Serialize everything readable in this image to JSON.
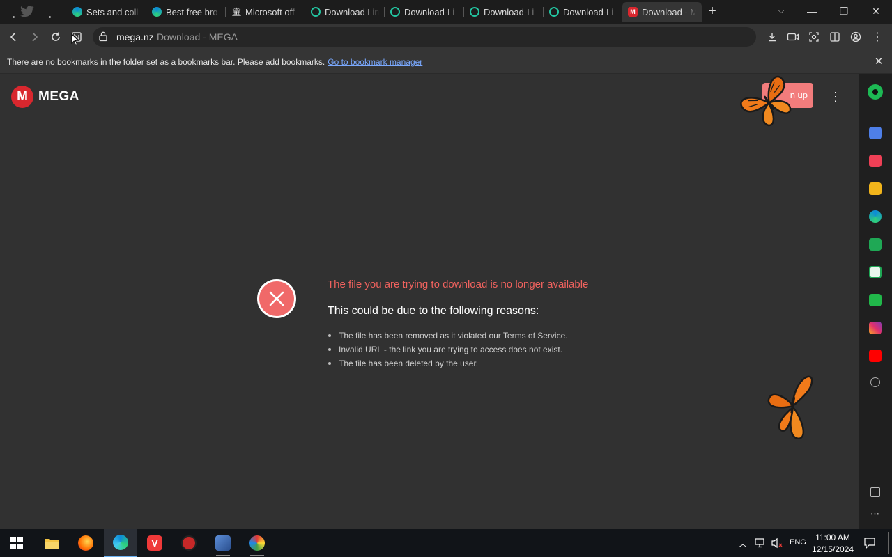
{
  "tabs": [
    {
      "title": "Sets and coll",
      "favicon": "edge-icon"
    },
    {
      "title": "Best free bro",
      "favicon": "edge-icon"
    },
    {
      "title": "Microsoft off",
      "favicon": "building-icon"
    },
    {
      "title": "Download Lin",
      "favicon": "ring-icon"
    },
    {
      "title": "Download-Li",
      "favicon": "ring-icon"
    },
    {
      "title": "Download-Li",
      "favicon": "ring-icon"
    },
    {
      "title": "Download-Li",
      "favicon": "ring-icon"
    },
    {
      "title": "Download - M",
      "favicon": "mega-icon",
      "active": true
    }
  ],
  "new_tab_label": "+",
  "window": {
    "minimize": "—",
    "restore": "❐",
    "close": "✕"
  },
  "toolbar": {
    "url_host": "mega.nz",
    "url_title": "Download - MEGA"
  },
  "bookmarks_bar": {
    "message": "There are no bookmarks in the folder set as a bookmarks bar. Please add bookmarks.",
    "link": "Go to bookmark manager",
    "close": "✕"
  },
  "page": {
    "logo_letter": "M",
    "logo_text": "MEGA",
    "signup_label": "n up",
    "menu_dots": "⋮",
    "error_title": "The file you are trying to download is no longer available",
    "error_subtitle": "This could be due to the following reasons:",
    "reasons": [
      "The file has been removed as it violated our Terms of Service.",
      "Invalid URL - the link you are trying to access does not exist.",
      "The file has been deleted by the user."
    ]
  },
  "taskbar": {
    "language": "ENG",
    "time": "11:00 AM",
    "date": "12/15/2024"
  },
  "colors": {
    "accent_red": "#d9272e",
    "error_text": "#f0625e",
    "link_blue": "#7aa9ff"
  }
}
